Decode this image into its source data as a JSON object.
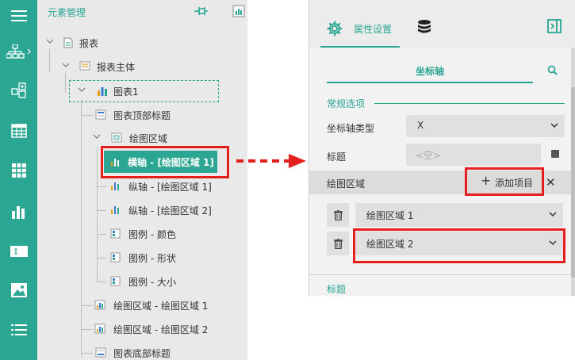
{
  "tree_panel": {
    "title": "元素管理",
    "items": [
      {
        "label": "报表"
      },
      {
        "label": "报表主体"
      },
      {
        "label": "图表1"
      },
      {
        "label": "图表顶部标题"
      },
      {
        "label": "绘图区域"
      },
      {
        "label": "横轴 - [绘图区域 1]"
      },
      {
        "label": "纵轴 - [绘图区域 1]"
      },
      {
        "label": "纵轴 - [绘图区域 2]"
      },
      {
        "label": "图例 - 颜色"
      },
      {
        "label": "图例 - 形状"
      },
      {
        "label": "图例 - 大小"
      },
      {
        "label": "绘图区域 - 绘图区域 1"
      },
      {
        "label": "绘图区域 - 绘图区域 2"
      },
      {
        "label": "图表底部标题"
      }
    ]
  },
  "property_panel": {
    "tab_label": "属性设置",
    "axis_tab": "坐标轴",
    "section_general": "常规选项",
    "axis_type_label": "坐标轴类型",
    "axis_type_value": "X",
    "title_label": "标题",
    "title_placeholder": "<空>",
    "plot_area_label": "绘图区域",
    "add_item_label": "添加项目",
    "plot_areas": [
      "绘图区域 1",
      "绘图区域 2"
    ],
    "section_title": "标题"
  },
  "colors": {
    "accent": "#2aa693",
    "highlight": "#e51e1e"
  },
  "icons": {
    "rail": [
      "menu-icon",
      "tree-icon",
      "layout-icon",
      "table-icon",
      "grid-icon",
      "bar-chart-icon",
      "textbox-icon",
      "image-icon",
      "list-icon"
    ]
  }
}
